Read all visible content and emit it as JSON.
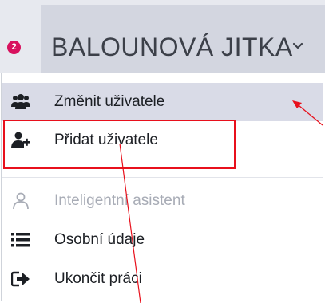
{
  "header": {
    "notification_count": "2",
    "user_name": "BALOUNOVÁ JITKA",
    "dropdown_icon": "chevron-down-icon"
  },
  "menu": {
    "items": [
      {
        "label": "Změnit uživatele",
        "icon": "users-icon",
        "state": "active"
      },
      {
        "label": "Přidat uživatele",
        "icon": "user-plus-icon",
        "state": "normal"
      },
      {
        "label": "Inteligentní asistent",
        "icon": "user-outline-icon",
        "state": "disabled"
      },
      {
        "label": "Osobní údaje",
        "icon": "list-icon",
        "state": "normal"
      },
      {
        "label": "Ukončit práci",
        "icon": "sign-out-icon",
        "state": "normal"
      }
    ]
  },
  "annotations": {
    "highlight_color": "#e8101c",
    "arrow_color": "#e8101c"
  },
  "colors": {
    "badge": "#d8115e",
    "header_bg": "#d3d6e0",
    "active_item_bg": "#d9dbe7",
    "disabled_text": "#a8acb6"
  }
}
